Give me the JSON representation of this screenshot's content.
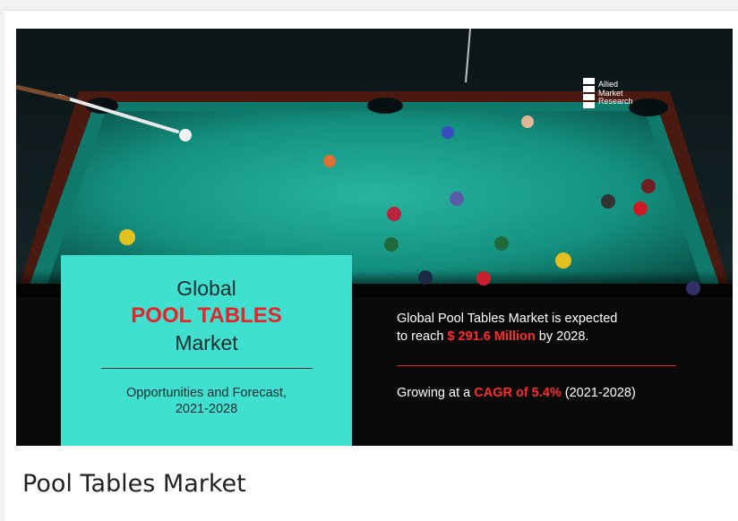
{
  "banner": {
    "box": {
      "line1": "Global",
      "line2": "POOL TABLES",
      "line3": "Market",
      "sub_line1": "Opportunities and Forecast,",
      "sub_line2": "2021-2028"
    },
    "stats": {
      "line1": "Global Pool Tables Market is expected",
      "line2_prefix": "to reach",
      "line2_value": "$ 291.6 Million",
      "line2_suffix": "by 2028.",
      "line3_prefix": "Growing at a",
      "line3_value": "CAGR of 5.4%",
      "line3_suffix": "(2021-2028)"
    },
    "logo": {
      "word1": "Allied",
      "word2": "Market",
      "word3": "Research"
    }
  },
  "caption": "Pool Tables Market",
  "colors": {
    "teal_box": "#40e0d0",
    "accent_red": "#e8242a",
    "felt": "#1aa08e",
    "rail": "#5a1e12"
  }
}
